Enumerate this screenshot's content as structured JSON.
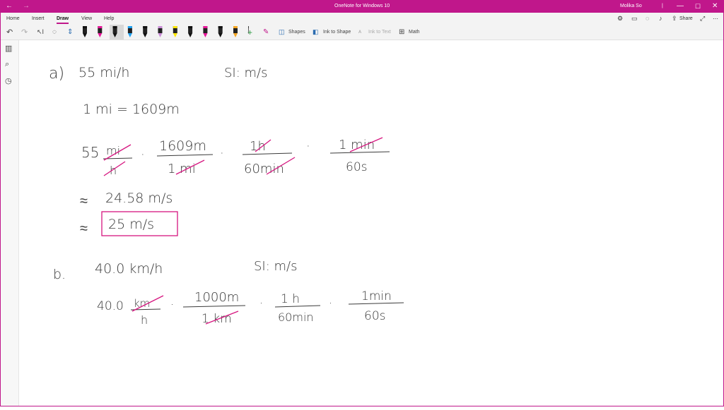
{
  "window": {
    "title": "OneNote for Windows 10",
    "user": "Molika So",
    "share_label": "Share"
  },
  "tabs": [
    "Home",
    "Insert",
    "Draw",
    "View",
    "Help"
  ],
  "active_tab": "Draw",
  "toolbar": {
    "shapes_label": "Shapes",
    "ink_to_shape_label": "Ink to Shape",
    "ink_to_text_label": "Ink to Text",
    "math_label": "Math",
    "pen_colors": [
      "#111111",
      "#e8159a",
      "#111111",
      "#1da1f2",
      "#111111",
      "#c98cd6",
      "#ffe600",
      "#111111",
      "#e8159a",
      "#111111",
      "#f5a623",
      "#111111"
    ]
  },
  "note": {
    "part_a": {
      "label": "a)",
      "given": "55 mi/h",
      "si": "SI: m/s",
      "conversion": "1 mi = 1609m",
      "f1_num": "55",
      "f1_top": "mi",
      "f1_bot": "h",
      "f2_top": "1609m",
      "f2_bot": "1 mi",
      "f3_top": "1h",
      "f3_bot": "60min",
      "f4_top": "1 min",
      "f4_bot": "60s",
      "approx_symbol": "≈",
      "result1": "24.58 m/s",
      "result2": "25 m/s"
    },
    "part_b": {
      "label": "b.",
      "given": "40.0 km/h",
      "si": "SI: m/s",
      "f1_num": "40.0",
      "f1_top": "km",
      "f1_bot": "h",
      "f2_top": "1000m",
      "f2_bot": "1 km",
      "f3_top": "1 h",
      "f3_bot": "60min",
      "f4_top": "1min",
      "f4_bot": "60s"
    },
    "dot": "·"
  }
}
